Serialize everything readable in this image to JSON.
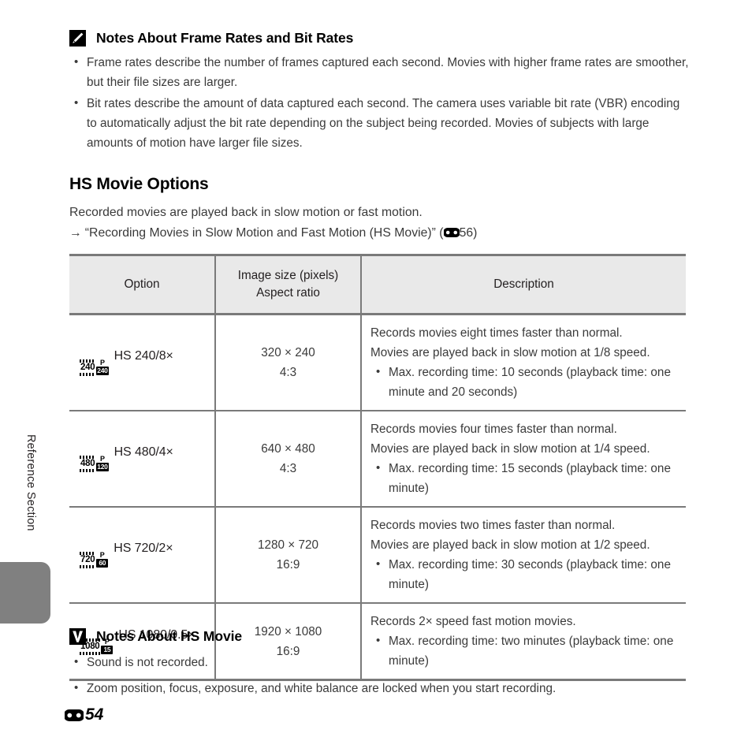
{
  "side_tab": {
    "label": "Reference Section"
  },
  "note_frame_rates": {
    "icon": "pencil-note-icon",
    "title": "Notes About Frame Rates and Bit Rates",
    "bullets": [
      "Frame rates describe the number of frames captured each second. Movies with higher frame rates are smoother, but their file sizes are larger.",
      "Bit rates describe the amount of data captured each second. The camera uses variable bit rate (VBR) encoding to automatically adjust the bit rate depending on the subject being recorded. Movies of subjects with large amounts of motion have larger file sizes."
    ]
  },
  "section": {
    "title": "HS Movie Options",
    "intro": "Recorded movies are played back in slow motion or fast motion.",
    "cross_ref": {
      "arrow": "→",
      "text": "“Recording Movies in Slow Motion and Fast Motion (HS Movie)” (",
      "ref_icon": "e-reference-icon",
      "ref_page": "56",
      "close": ")"
    }
  },
  "table": {
    "headers": {
      "option": "Option",
      "image_size_line1": "Image size (pixels)",
      "image_size_line2": "Aspect ratio",
      "description": "Description"
    },
    "rows": [
      {
        "icon": {
          "res": "240",
          "p": "P",
          "fps": "240"
        },
        "option_label": "HS 240/8×",
        "image_size": "320 × 240",
        "aspect_ratio": "4:3",
        "desc_lines": [
          "Records movies eight times faster than normal.",
          "Movies are played back in slow motion at 1/8 speed."
        ],
        "desc_bullets": [
          "Max. recording time: 10 seconds (playback time: one minute and 20 seconds)"
        ]
      },
      {
        "icon": {
          "res": "480",
          "p": "P",
          "fps": "120"
        },
        "option_label": "HS 480/4×",
        "image_size": "640 × 480",
        "aspect_ratio": "4:3",
        "desc_lines": [
          "Records movies four times faster than normal.",
          "Movies are played back in slow motion at 1/4 speed."
        ],
        "desc_bullets": [
          "Max. recording time: 15 seconds (playback time: one minute)"
        ]
      },
      {
        "icon": {
          "res": "720",
          "p": "P",
          "fps": "60"
        },
        "option_label": "HS 720/2×",
        "image_size": "1280 × 720",
        "aspect_ratio": "16:9",
        "desc_lines": [
          "Records movies two times faster than normal.",
          "Movies are played back in slow motion at 1/2 speed."
        ],
        "desc_bullets": [
          "Max. recording time: 30 seconds (playback time: one minute)"
        ]
      },
      {
        "icon": {
          "res": "1080",
          "p": "P",
          "fps": "15"
        },
        "option_label": "HS 1080/0.5×",
        "image_size": "1920 × 1080",
        "aspect_ratio": "16:9",
        "desc_lines": [
          "Records 2× speed fast motion movies."
        ],
        "desc_bullets": [
          "Max. recording time: two minutes (playback time: one minute)"
        ]
      }
    ]
  },
  "note_hs_movie": {
    "icon": "warning-check-icon",
    "title": "Notes About HS Movie",
    "bullets": [
      "Sound is not recorded.",
      "Zoom position, focus, exposure, and white balance are locked when you start recording."
    ]
  },
  "footer": {
    "ref_icon": "e-reference-icon",
    "page_number": "54"
  },
  "colors": {
    "text": "#3a3a3a",
    "heading": "#000000",
    "table_border": "#7a7a7a",
    "table_header_bg": "#e9e9e9",
    "side_tab": "#808080"
  }
}
